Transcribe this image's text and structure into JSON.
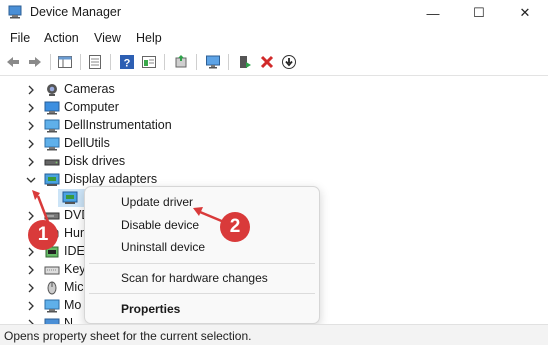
{
  "window": {
    "title": "Device Manager",
    "minimize": "—",
    "maximize": "☐",
    "close": "✕"
  },
  "menu": [
    "File",
    "Action",
    "View",
    "Help"
  ],
  "toolbar_icons": [
    "back-arrow-icon",
    "forward-arrow-icon",
    "show-hide-tree-icon",
    "properties-icon",
    "help-icon",
    "action-view-icon",
    "update-driver-icon",
    "scan-monitor-icon",
    "enable-device-icon",
    "uninstall-x-icon",
    "disable-download-icon"
  ],
  "tree": [
    {
      "label": "Cameras",
      "icon": "camera-icon",
      "expanded": false
    },
    {
      "label": "Computer",
      "icon": "computer-icon",
      "expanded": false
    },
    {
      "label": "DellInstrumentation",
      "icon": "monitor-icon",
      "expanded": false
    },
    {
      "label": "DellUtils",
      "icon": "monitor-icon",
      "expanded": false
    },
    {
      "label": "Disk drives",
      "icon": "disk-drive-icon",
      "expanded": false
    },
    {
      "label": "Display adapters",
      "icon": "display-adapter-icon",
      "expanded": true
    },
    {
      "label": "",
      "icon": "display-adapter-icon",
      "child": true
    },
    {
      "label": "DVD",
      "icon": "dvd-drive-icon",
      "expanded": false
    },
    {
      "label": "Hum",
      "icon": "hid-icon",
      "expanded": false
    },
    {
      "label": "IDE",
      "icon": "ide-controller-icon",
      "expanded": false
    },
    {
      "label": "Key",
      "icon": "keyboard-icon",
      "expanded": false
    },
    {
      "label": "Mic",
      "icon": "mouse-icon",
      "expanded": false
    },
    {
      "label": "Mo",
      "icon": "monitor-icon",
      "expanded": false
    },
    {
      "label": "N",
      "icon": "network-icon",
      "expanded": false
    }
  ],
  "context_menu": {
    "update": "Update driver",
    "disable": "Disable device",
    "uninstall": "Uninstall device",
    "scan": "Scan for hardware changes",
    "properties": "Properties"
  },
  "annotations": {
    "step1": "1",
    "step2": "2",
    "color": "#d93a3a"
  },
  "status": "Opens property sheet for the current selection."
}
